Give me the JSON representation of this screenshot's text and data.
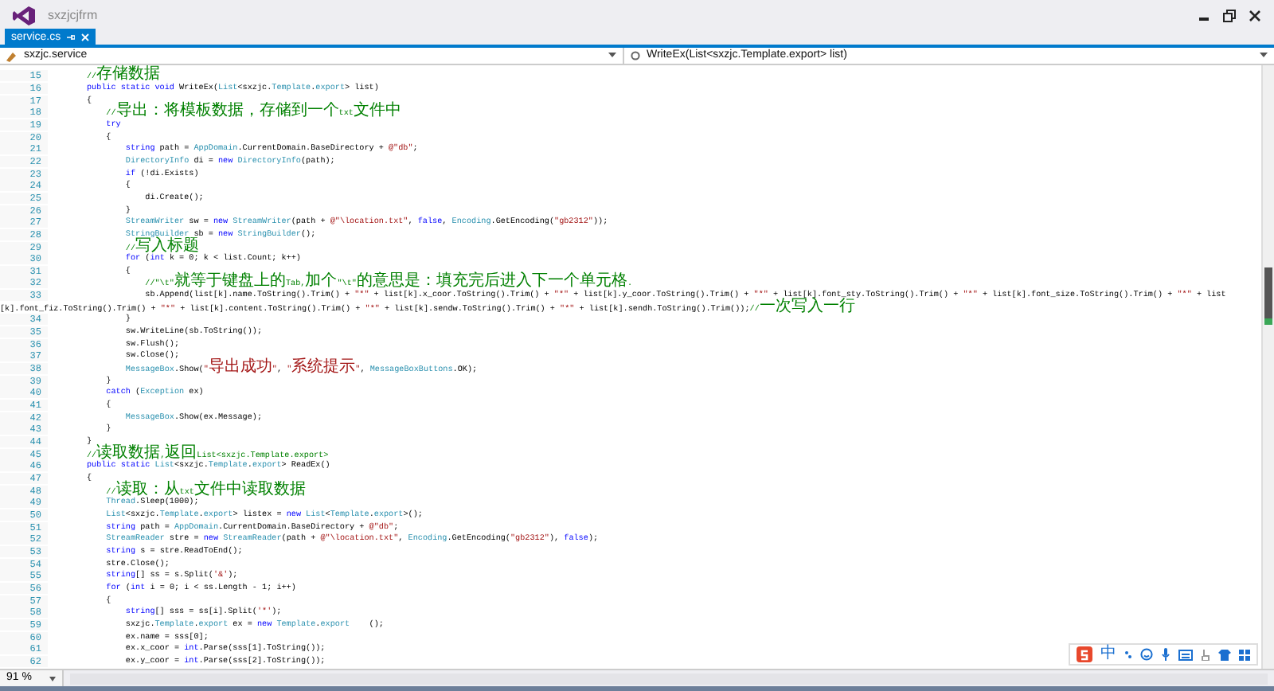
{
  "window": {
    "title": "sxzjcjfrm"
  },
  "tabs": [
    {
      "label": "service.cs",
      "selected": true
    }
  ],
  "navigation_bar": {
    "type_dropdown": "sxzjc.service",
    "member_dropdown": "WriteEx(List<sxzjc.Template.export> list)"
  },
  "editor": {
    "lines": [
      {
        "number": "15",
        "segments": [
          {
            "kind": "comment",
            "text": "        //存储数据"
          }
        ]
      },
      {
        "number": "16",
        "segments": [
          {
            "kind": "keyword",
            "text": "        public static void"
          },
          {
            "kind": "plain",
            "text": " WriteEx("
          },
          {
            "kind": "type",
            "text": "List"
          },
          {
            "kind": "plain",
            "text": "<sxzjc."
          },
          {
            "kind": "type",
            "text": "Template"
          },
          {
            "kind": "plain",
            "text": "."
          },
          {
            "kind": "type",
            "text": "export"
          },
          {
            "kind": "plain",
            "text": "> list)"
          }
        ]
      },
      {
        "number": "17",
        "segments": [
          {
            "kind": "plain",
            "text": "        {"
          }
        ]
      },
      {
        "number": "18",
        "segments": [
          {
            "kind": "comment",
            "text": "            //导出：将模板数据，存储到一个txt文件中"
          }
        ]
      },
      {
        "number": "19",
        "segments": [
          {
            "kind": "keyword",
            "text": "            try"
          }
        ]
      },
      {
        "number": "20",
        "segments": [
          {
            "kind": "plain",
            "text": "            {"
          }
        ]
      },
      {
        "number": "21",
        "segments": [
          {
            "kind": "keyword",
            "text": "                string"
          },
          {
            "kind": "plain",
            "text": " path = "
          },
          {
            "kind": "type",
            "text": "AppDomain"
          },
          {
            "kind": "plain",
            "text": ".CurrentDomain.BaseDirectory + "
          },
          {
            "kind": "string",
            "text": "@\"db\""
          },
          {
            "kind": "plain",
            "text": ";"
          }
        ]
      },
      {
        "number": "22",
        "segments": [
          {
            "kind": "type",
            "text": "                DirectoryInfo"
          },
          {
            "kind": "plain",
            "text": " di = "
          },
          {
            "kind": "keyword",
            "text": "new"
          },
          {
            "kind": "type",
            "text": " DirectoryInfo"
          },
          {
            "kind": "plain",
            "text": "(path);"
          }
        ]
      },
      {
        "number": "23",
        "segments": [
          {
            "kind": "keyword",
            "text": "                if"
          },
          {
            "kind": "plain",
            "text": " (!di.Exists)"
          }
        ]
      },
      {
        "number": "24",
        "segments": [
          {
            "kind": "plain",
            "text": "                {"
          }
        ]
      },
      {
        "number": "25",
        "segments": [
          {
            "kind": "plain",
            "text": "                    di.Create();"
          }
        ]
      },
      {
        "number": "26",
        "segments": [
          {
            "kind": "plain",
            "text": "                }"
          }
        ]
      },
      {
        "number": "27",
        "segments": [
          {
            "kind": "type",
            "text": "                StreamWriter"
          },
          {
            "kind": "plain",
            "text": " sw = "
          },
          {
            "kind": "keyword",
            "text": "new"
          },
          {
            "kind": "type",
            "text": " StreamWriter"
          },
          {
            "kind": "plain",
            "text": "(path + "
          },
          {
            "kind": "string",
            "text": "@\"\\location.txt\""
          },
          {
            "kind": "plain",
            "text": ", "
          },
          {
            "kind": "keyword",
            "text": "false"
          },
          {
            "kind": "plain",
            "text": ", "
          },
          {
            "kind": "type",
            "text": "Encoding"
          },
          {
            "kind": "plain",
            "text": ".GetEncoding("
          },
          {
            "kind": "string",
            "text": "\"gb2312\""
          },
          {
            "kind": "plain",
            "text": "));"
          }
        ]
      },
      {
        "number": "28",
        "segments": [
          {
            "kind": "type",
            "text": "                StringBuilder"
          },
          {
            "kind": "plain",
            "text": " sb = "
          },
          {
            "kind": "keyword",
            "text": "new"
          },
          {
            "kind": "type",
            "text": " StringBuilder"
          },
          {
            "kind": "plain",
            "text": "();"
          }
        ]
      },
      {
        "number": "29",
        "segments": [
          {
            "kind": "comment",
            "text": "                //写入标题"
          }
        ]
      },
      {
        "number": "30",
        "segments": [
          {
            "kind": "keyword",
            "text": "                for"
          },
          {
            "kind": "plain",
            "text": " ("
          },
          {
            "kind": "keyword",
            "text": "int"
          },
          {
            "kind": "plain",
            "text": " k = 0; k < list.Count; k++)"
          }
        ]
      },
      {
        "number": "31",
        "segments": [
          {
            "kind": "plain",
            "text": "                {"
          }
        ]
      },
      {
        "number": "32",
        "segments": [
          {
            "kind": "comment",
            "text": "                    //\"\\t\"就等于键盘上的Tab,加个\"\\t\"的意思是：填充完后进入下一个单元格."
          }
        ]
      },
      {
        "number": "33",
        "segments": [
          {
            "kind": "plain",
            "text": "                    sb.Append(list[k].name.ToString().Trim() + "
          },
          {
            "kind": "string",
            "text": "\"*\""
          },
          {
            "kind": "plain",
            "text": " + list[k].x_coor.ToString().Trim() + "
          },
          {
            "kind": "string",
            "text": "\"*\""
          },
          {
            "kind": "plain",
            "text": " + list[k].y_coor.ToString().Trim() + "
          },
          {
            "kind": "string",
            "text": "\"*\""
          },
          {
            "kind": "plain",
            "text": " + list[k].font_sty.ToString().Trim() + "
          },
          {
            "kind": "string",
            "text": "\"*\""
          },
          {
            "kind": "plain",
            "text": " + list[k].font_size.ToString().Trim() + "
          },
          {
            "kind": "string",
            "text": "\"*\""
          },
          {
            "kind": "plain",
            "text": " + list"
          }
        ]
      },
      {
        "segments": [
          {
            "kind": "plain",
            "text": "[k].font_fiz.ToString().Trim() + "
          },
          {
            "kind": "string",
            "text": "\"*\""
          },
          {
            "kind": "plain",
            "text": " + list[k].content.ToString().Trim() + "
          },
          {
            "kind": "string",
            "text": "\"*\""
          },
          {
            "kind": "plain",
            "text": " + list[k].sendw.ToString().Trim() + "
          },
          {
            "kind": "string",
            "text": "\"*\""
          },
          {
            "kind": "plain",
            "text": " + list[k].sendh.ToString().Trim());"
          },
          {
            "kind": "comment",
            "text": "//一次写入一行"
          }
        ]
      },
      {
        "number": "34",
        "segments": [
          {
            "kind": "plain",
            "text": "                }"
          }
        ]
      },
      {
        "number": "35",
        "segments": [
          {
            "kind": "plain",
            "text": "                sw.WriteLine(sb.ToString());"
          }
        ]
      },
      {
        "number": "36",
        "segments": [
          {
            "kind": "plain",
            "text": "                sw.Flush();"
          }
        ]
      },
      {
        "number": "37",
        "segments": [
          {
            "kind": "plain",
            "text": "                sw.Close();"
          }
        ]
      },
      {
        "number": "38",
        "segments": [
          {
            "kind": "type",
            "text": "                MessageBox"
          },
          {
            "kind": "plain",
            "text": ".Show("
          },
          {
            "kind": "string",
            "text": "\"导出成功\""
          },
          {
            "kind": "plain",
            "text": ", "
          },
          {
            "kind": "string",
            "text": "\"系统提示\""
          },
          {
            "kind": "plain",
            "text": ", "
          },
          {
            "kind": "type",
            "text": "MessageBoxButtons"
          },
          {
            "kind": "plain",
            "text": ".OK);"
          }
        ]
      },
      {
        "number": "39",
        "segments": [
          {
            "kind": "plain",
            "text": "            }"
          }
        ]
      },
      {
        "number": "40",
        "segments": [
          {
            "kind": "keyword",
            "text": "            catch"
          },
          {
            "kind": "plain",
            "text": " ("
          },
          {
            "kind": "type",
            "text": "Exception"
          },
          {
            "kind": "plain",
            "text": " ex)"
          }
        ]
      },
      {
        "number": "41",
        "segments": [
          {
            "kind": "plain",
            "text": "            {"
          }
        ]
      },
      {
        "number": "42",
        "segments": [
          {
            "kind": "type",
            "text": "                MessageBox"
          },
          {
            "kind": "plain",
            "text": ".Show(ex.Message);"
          }
        ]
      },
      {
        "number": "43",
        "segments": [
          {
            "kind": "plain",
            "text": "            }"
          }
        ]
      },
      {
        "number": "44",
        "segments": [
          {
            "kind": "plain",
            "text": "        }"
          }
        ]
      },
      {
        "number": "45",
        "segments": [
          {
            "kind": "comment",
            "text": "        //读取数据,返回List<sxzjc.Template.export>"
          }
        ]
      },
      {
        "number": "46",
        "segments": [
          {
            "kind": "keyword",
            "text": "        public static"
          },
          {
            "kind": "type",
            "text": " List"
          },
          {
            "kind": "plain",
            "text": "<sxzjc."
          },
          {
            "kind": "type",
            "text": "Template"
          },
          {
            "kind": "plain",
            "text": "."
          },
          {
            "kind": "type",
            "text": "export"
          },
          {
            "kind": "plain",
            "text": "> ReadEx()"
          }
        ]
      },
      {
        "number": "47",
        "segments": [
          {
            "kind": "plain",
            "text": "        {"
          }
        ]
      },
      {
        "number": "48",
        "segments": [
          {
            "kind": "comment",
            "text": "            //读取：从txt文件中读取数据"
          }
        ]
      },
      {
        "number": "49",
        "segments": [
          {
            "kind": "type",
            "text": "            Thread"
          },
          {
            "kind": "plain",
            "text": ".Sleep(1000);"
          }
        ]
      },
      {
        "number": "50",
        "segments": [
          {
            "kind": "type",
            "text": "            List"
          },
          {
            "kind": "plain",
            "text": "<sxzjc."
          },
          {
            "kind": "type",
            "text": "Template"
          },
          {
            "kind": "plain",
            "text": "."
          },
          {
            "kind": "type",
            "text": "export"
          },
          {
            "kind": "plain",
            "text": "> listex = "
          },
          {
            "kind": "keyword",
            "text": "new"
          },
          {
            "kind": "type",
            "text": " List"
          },
          {
            "kind": "plain",
            "text": "<"
          },
          {
            "kind": "type",
            "text": "Template"
          },
          {
            "kind": "plain",
            "text": "."
          },
          {
            "kind": "type",
            "text": "export"
          },
          {
            "kind": "plain",
            "text": ">();"
          }
        ]
      },
      {
        "number": "51",
        "segments": [
          {
            "kind": "keyword",
            "text": "            string"
          },
          {
            "kind": "plain",
            "text": " path = "
          },
          {
            "kind": "type",
            "text": "AppDomain"
          },
          {
            "kind": "plain",
            "text": ".CurrentDomain.BaseDirectory + "
          },
          {
            "kind": "string",
            "text": "@\"db\""
          },
          {
            "kind": "plain",
            "text": ";"
          }
        ]
      },
      {
        "number": "52",
        "segments": [
          {
            "kind": "type",
            "text": "            StreamReader"
          },
          {
            "kind": "plain",
            "text": " stre = "
          },
          {
            "kind": "keyword",
            "text": "new"
          },
          {
            "kind": "type",
            "text": " StreamReader"
          },
          {
            "kind": "plain",
            "text": "(path + "
          },
          {
            "kind": "string",
            "text": "@\"\\location.txt\""
          },
          {
            "kind": "plain",
            "text": ", "
          },
          {
            "kind": "type",
            "text": "Encoding"
          },
          {
            "kind": "plain",
            "text": ".GetEncoding("
          },
          {
            "kind": "string",
            "text": "\"gb2312\""
          },
          {
            "kind": "plain",
            "text": "), "
          },
          {
            "kind": "keyword",
            "text": "false"
          },
          {
            "kind": "plain",
            "text": ");"
          }
        ]
      },
      {
        "number": "53",
        "segments": [
          {
            "kind": "keyword",
            "text": "            string"
          },
          {
            "kind": "plain",
            "text": " s = stre.ReadToEnd();"
          }
        ]
      },
      {
        "number": "54",
        "segments": [
          {
            "kind": "plain",
            "text": "            stre.Close();"
          }
        ]
      },
      {
        "number": "55",
        "segments": [
          {
            "kind": "keyword",
            "text": "            string"
          },
          {
            "kind": "plain",
            "text": "[] ss = s.Split("
          },
          {
            "kind": "string",
            "text": "'&'"
          },
          {
            "kind": "plain",
            "text": ");"
          }
        ]
      },
      {
        "number": "56",
        "segments": [
          {
            "kind": "keyword",
            "text": "            for"
          },
          {
            "kind": "plain",
            "text": " ("
          },
          {
            "kind": "keyword",
            "text": "int"
          },
          {
            "kind": "plain",
            "text": " i = 0; i < ss.Length - 1; i++)"
          }
        ]
      },
      {
        "number": "57",
        "segments": [
          {
            "kind": "plain",
            "text": "            {"
          }
        ]
      },
      {
        "number": "58",
        "segments": [
          {
            "kind": "keyword",
            "text": "                string"
          },
          {
            "kind": "plain",
            "text": "[] sss = ss[i].Split("
          },
          {
            "kind": "string",
            "text": "'*'"
          },
          {
            "kind": "plain",
            "text": ");"
          }
        ]
      },
      {
        "number": "59",
        "segments": [
          {
            "kind": "plain",
            "text": "                sxzjc."
          },
          {
            "kind": "type",
            "text": "Template"
          },
          {
            "kind": "plain",
            "text": "."
          },
          {
            "kind": "type",
            "text": "export"
          },
          {
            "kind": "plain",
            "text": " ex = "
          },
          {
            "kind": "keyword",
            "text": "new"
          },
          {
            "kind": "type",
            "text": " Template"
          },
          {
            "kind": "plain",
            "text": "."
          },
          {
            "kind": "type",
            "text": "export"
          },
          {
            "kind": "plain",
            "text": "    ();"
          }
        ]
      },
      {
        "number": "60",
        "segments": [
          {
            "kind": "plain",
            "text": "                ex.name = sss[0];"
          }
        ]
      },
      {
        "number": "61",
        "segments": [
          {
            "kind": "plain",
            "text": "                ex.x_coor = "
          },
          {
            "kind": "keyword",
            "text": "int"
          },
          {
            "kind": "plain",
            "text": ".Parse(sss[1].ToString());"
          }
        ]
      },
      {
        "number": "62",
        "segments": [
          {
            "kind": "plain",
            "text": "                ex.y_coor = "
          },
          {
            "kind": "keyword",
            "text": "int"
          },
          {
            "kind": "plain",
            "text": ".Parse(sss[2].ToString());"
          }
        ]
      }
    ]
  },
  "status_bar": {
    "zoom": "91 %"
  },
  "ime_toolbar": {
    "mode": "中"
  }
}
